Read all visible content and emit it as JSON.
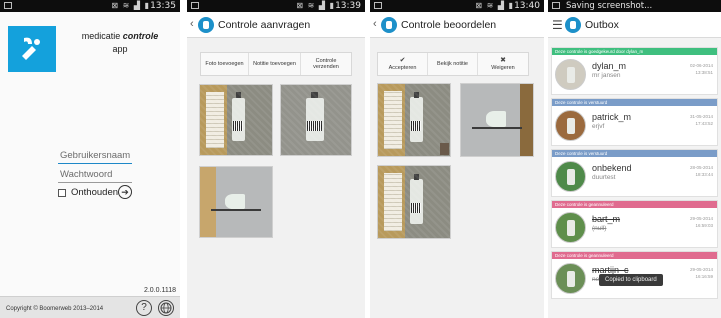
{
  "phone1": {
    "status_time": "13:35",
    "app_name_prefix": "medicatie",
    "app_name_bold": "controle",
    "app_name_suffix": "app",
    "username_placeholder": "Gebruikersnaam",
    "password_placeholder": "Wachtwoord",
    "remember_label": "Onthouden",
    "version": "2.0.0.1118",
    "copyright": "Copyright © Boomerweb 2013–2014"
  },
  "phone2": {
    "status_time": "13:39",
    "title": "Controle aanvragen",
    "tabs": [
      "Foto toevoegen",
      "Notitie toevoegen",
      "Controle verzenden"
    ]
  },
  "phone3": {
    "status_time": "13:40",
    "title": "Controle beoordelen",
    "tabs": [
      {
        "icon": "check-icon",
        "label": "Accepteren"
      },
      {
        "icon": "",
        "label": "Bekijk notitie"
      },
      {
        "icon": "x-icon",
        "label": "Weigeren"
      }
    ]
  },
  "phone4": {
    "status_text": "Saving screenshot...",
    "title": "Outbox",
    "items": [
      {
        "banner": "Deze controle is goedgekeurd door dylan_m",
        "banner_color": "#3fbf7f",
        "name": "dylan_m",
        "sub": "mr jansen",
        "date": "02-06-2014",
        "time": "13:38:51",
        "struck": false
      },
      {
        "banner": "Deze controle is verstuurd",
        "banner_color": "#7a9cc8",
        "name": "patrick_m",
        "sub": "erjvf",
        "date": "31-05-2014",
        "time": "17:43:52",
        "struck": false
      },
      {
        "banner": "Deze controle is verstuurd",
        "banner_color": "#7a9cc8",
        "name": "onbekend",
        "sub": "duurtest",
        "date": "28-05-2014",
        "time": "18:33:44",
        "struck": false
      },
      {
        "banner": "Deze controle is geannuleerd",
        "banner_color": "#e06b8f",
        "name": "bart_m",
        "sub": "(null)",
        "date": "29-05-2014",
        "time": "16:59:03",
        "struck": true
      },
      {
        "banner": "Deze controle is geannuleerd",
        "banner_color": "#e06b8f",
        "name": "martijn_c",
        "sub": "newcancelpls",
        "date": "29-05-2014",
        "time": "16:16:59",
        "struck": true
      }
    ],
    "toast": "Copied to clipboard"
  }
}
